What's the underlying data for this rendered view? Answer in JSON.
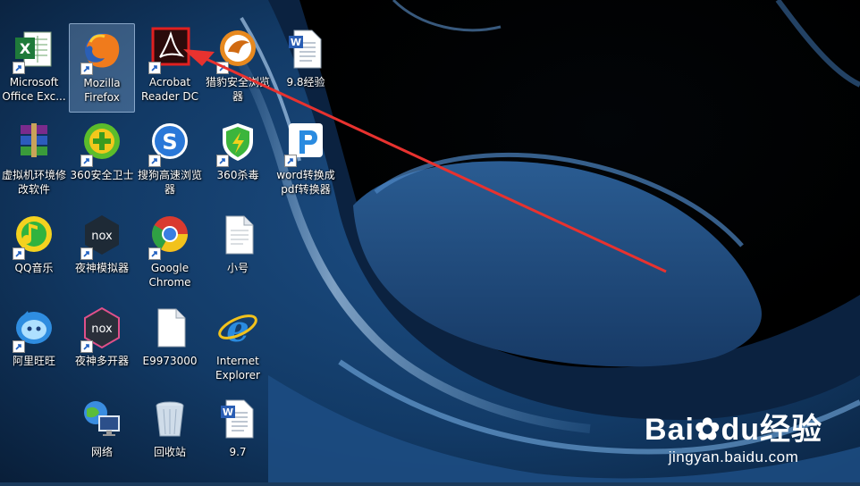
{
  "desktop": {
    "icons": [
      {
        "label": "Microsoft\nOffice Exc...",
        "icon": "excel-icon"
      },
      {
        "label": "Mozilla\nFirefox",
        "icon": "firefox-icon"
      },
      {
        "label": "Acrobat\nReader DC",
        "icon": "acrobat-icon"
      },
      {
        "label": "猎豹安全浏览\n器",
        "icon": "cheetah-browser-icon"
      },
      {
        "label": "9.8经验",
        "icon": "word-doc-icon"
      },
      {
        "label": "虚拟机环境修\n改软件",
        "icon": "winrar-icon"
      },
      {
        "label": "360安全卫士",
        "icon": "360-safe-icon"
      },
      {
        "label": "搜狗高速浏览\n器",
        "icon": "sogou-browser-icon"
      },
      {
        "label": "360杀毒",
        "icon": "360-antivirus-icon"
      },
      {
        "label": "word转换成\npdf转换器",
        "icon": "pdf-converter-icon"
      },
      {
        "label": "QQ音乐",
        "icon": "qq-music-icon"
      },
      {
        "label": "夜神模拟器",
        "icon": "nox-icon"
      },
      {
        "label": "Google\nChrome",
        "icon": "chrome-icon"
      },
      {
        "label": "小号",
        "icon": "text-file-icon"
      },
      {
        "label": "阿里旺旺",
        "icon": "aliwangwang-icon"
      },
      {
        "label": "夜神多开器",
        "icon": "nox-multi-icon"
      },
      {
        "label": "E9973000",
        "icon": "blank-file-icon"
      },
      {
        "label": "Internet\nExplorer",
        "icon": "ie-icon"
      },
      {
        "label": "网络",
        "icon": "network-icon"
      },
      {
        "label": "回收站",
        "icon": "recycle-bin-icon"
      },
      {
        "label": "9.7",
        "icon": "word-doc-icon"
      }
    ]
  },
  "watermark": {
    "logo": "Bai du 经验",
    "logo_left": "Bai",
    "logo_mid": "du",
    "logo_right": "经验",
    "site": "jingyan.baidu.com"
  },
  "colors": {
    "annotation_arrow": "#e8322f",
    "highlight_box": "#e02020",
    "selection": "#aacdf5"
  }
}
